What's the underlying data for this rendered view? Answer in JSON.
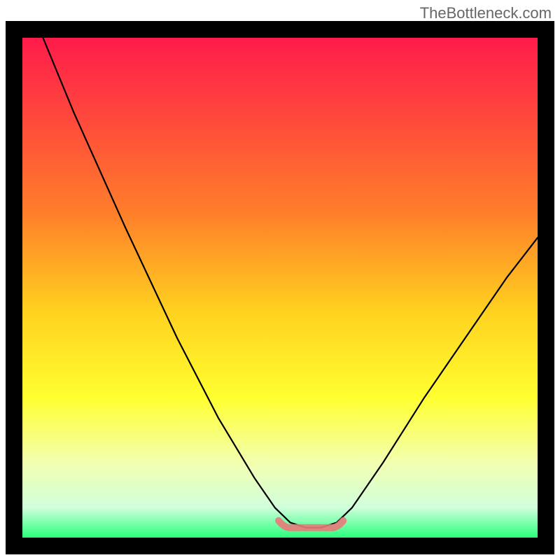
{
  "watermark": "TheBottleneck.com",
  "chart_data": {
    "type": "line",
    "title": "",
    "xlabel": "",
    "ylabel": "",
    "xlim": [
      0,
      100
    ],
    "ylim": [
      0,
      100
    ],
    "gradient_stops": [
      {
        "offset": 0,
        "color": "#ff1b4b"
      },
      {
        "offset": 35,
        "color": "#ff7e2a"
      },
      {
        "offset": 55,
        "color": "#ffd21f"
      },
      {
        "offset": 72,
        "color": "#ffff30"
      },
      {
        "offset": 85,
        "color": "#f3ffb0"
      },
      {
        "offset": 94,
        "color": "#d0ffdc"
      },
      {
        "offset": 100,
        "color": "#2aff7c"
      }
    ],
    "curve": [
      {
        "x": 4,
        "y": 100
      },
      {
        "x": 10,
        "y": 85
      },
      {
        "x": 20,
        "y": 62
      },
      {
        "x": 30,
        "y": 40
      },
      {
        "x": 38,
        "y": 24
      },
      {
        "x": 45,
        "y": 12
      },
      {
        "x": 49,
        "y": 6
      },
      {
        "x": 52,
        "y": 3
      },
      {
        "x": 55,
        "y": 2
      },
      {
        "x": 58,
        "y": 2
      },
      {
        "x": 61,
        "y": 3
      },
      {
        "x": 64,
        "y": 6
      },
      {
        "x": 70,
        "y": 15
      },
      {
        "x": 78,
        "y": 28
      },
      {
        "x": 86,
        "y": 40
      },
      {
        "x": 94,
        "y": 52
      },
      {
        "x": 100,
        "y": 60
      }
    ],
    "marker_band": {
      "x0": 50,
      "x1": 62,
      "y": 2,
      "color": "#e97a7a"
    },
    "frame_color": "#000000",
    "frame_thickness": 24
  }
}
